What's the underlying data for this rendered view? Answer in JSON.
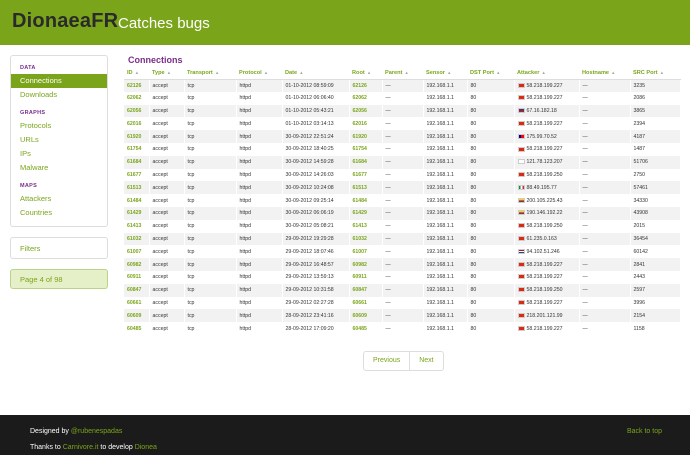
{
  "header": {
    "brand": "DionaeaFR",
    "tagline": "Catches bugs"
  },
  "sidebar": {
    "data_header": "DATA",
    "data_items": [
      "Connections",
      "Downloads"
    ],
    "graphs_header": "GRAPHS",
    "graphs_items": [
      "Protocols",
      "URLs",
      "IPs",
      "Malware"
    ],
    "maps_header": "MAPS",
    "maps_items": [
      "Attackers",
      "Countries"
    ],
    "filters": "Filters",
    "page_info": "Page 4 of 98"
  },
  "main": {
    "title": "Connections",
    "columns": [
      "ID",
      "Type",
      "Transport",
      "Protocol",
      "Date",
      "Root",
      "Parent",
      "Sensor",
      "DST Port",
      "Attacker",
      "Hostname",
      "SRC Port"
    ],
    "rows": [
      [
        "62126",
        "accept",
        "tcp",
        "httpd",
        "01-10-2012 08:59:09",
        "62126",
        "—",
        "192.168.1.1",
        "80",
        "58.218.199.227",
        "—",
        "3235"
      ],
      [
        "62062",
        "accept",
        "tcp",
        "httpd",
        "01-10-2012 06:06:40",
        "62062",
        "—",
        "192.168.1.1",
        "80",
        "58.218.199.227",
        "—",
        "2086"
      ],
      [
        "62056",
        "accept",
        "tcp",
        "httpd",
        "01-10-2012 05:43:21",
        "62056",
        "—",
        "192.168.1.1",
        "80",
        "67.16.182.18",
        "—",
        "3865"
      ],
      [
        "62016",
        "accept",
        "tcp",
        "httpd",
        "01-10-2012 03:14:13",
        "62016",
        "—",
        "192.168.1.1",
        "80",
        "58.218.199.227",
        "—",
        "2394"
      ],
      [
        "61920",
        "accept",
        "tcp",
        "httpd",
        "30-09-2012 22:51:24",
        "61920",
        "—",
        "192.168.1.1",
        "80",
        "175.99.70.52",
        "—",
        "4187"
      ],
      [
        "61754",
        "accept",
        "tcp",
        "httpd",
        "30-09-2012 18:40:25",
        "61754",
        "—",
        "192.168.1.1",
        "80",
        "58.218.199.227",
        "—",
        "1487"
      ],
      [
        "61684",
        "accept",
        "tcp",
        "httpd",
        "30-09-2012 14:59:28",
        "61684",
        "—",
        "192.168.1.1",
        "80",
        "121.78.123.207",
        "—",
        "51706"
      ],
      [
        "61677",
        "accept",
        "tcp",
        "httpd",
        "30-09-2012 14:26:03",
        "61677",
        "—",
        "192.168.1.1",
        "80",
        "58.218.199.250",
        "—",
        "2750"
      ],
      [
        "61513",
        "accept",
        "tcp",
        "httpd",
        "30-09-2012 10:24:08",
        "61513",
        "—",
        "192.168.1.1",
        "80",
        "88.49.195.77",
        "—",
        "57461"
      ],
      [
        "61484",
        "accept",
        "tcp",
        "httpd",
        "30-09-2012 09:25:14",
        "61484",
        "—",
        "192.168.1.1",
        "80",
        "200.105.225.43",
        "—",
        "34330"
      ],
      [
        "61429",
        "accept",
        "tcp",
        "httpd",
        "30-09-2012 06:06:19",
        "61429",
        "—",
        "192.168.1.1",
        "80",
        "190.146.192.22",
        "—",
        "43908"
      ],
      [
        "61413",
        "accept",
        "tcp",
        "httpd",
        "30-09-2012 05:08:21",
        "61413",
        "—",
        "192.168.1.1",
        "80",
        "58.218.199.250",
        "—",
        "2015"
      ],
      [
        "61032",
        "accept",
        "tcp",
        "httpd",
        "29-09-2012 19:29:28",
        "61032",
        "—",
        "192.168.1.1",
        "80",
        "61.235.0.163",
        "—",
        "36454"
      ],
      [
        "61007",
        "accept",
        "tcp",
        "httpd",
        "29-09-2012 18:07:46",
        "61007",
        "—",
        "192.168.1.1",
        "80",
        "94.102.51.246",
        "—",
        "60142"
      ],
      [
        "60982",
        "accept",
        "tcp",
        "httpd",
        "29-09-2012 16:48:57",
        "60982",
        "—",
        "192.168.1.1",
        "80",
        "58.218.199.227",
        "—",
        "2841"
      ],
      [
        "60911",
        "accept",
        "tcp",
        "httpd",
        "29-09-2012 13:59:13",
        "60911",
        "—",
        "192.168.1.1",
        "80",
        "58.218.199.227",
        "—",
        "2443"
      ],
      [
        "60847",
        "accept",
        "tcp",
        "httpd",
        "29-09-2012 10:31:58",
        "60847",
        "—",
        "192.168.1.1",
        "80",
        "58.218.199.250",
        "—",
        "2597"
      ],
      [
        "60661",
        "accept",
        "tcp",
        "httpd",
        "29-09-2012 02:27:28",
        "60661",
        "—",
        "192.168.1.1",
        "80",
        "58.218.199.227",
        "—",
        "3996"
      ],
      [
        "60609",
        "accept",
        "tcp",
        "httpd",
        "28-09-2012 23:41:16",
        "60609",
        "—",
        "192.168.1.1",
        "80",
        "218.201.121.99",
        "—",
        "2154"
      ],
      [
        "60485",
        "accept",
        "tcp",
        "httpd",
        "28-09-2012 17:09:20",
        "60485",
        "—",
        "192.168.1.1",
        "80",
        "58.218.199.227",
        "—",
        "1158"
      ]
    ],
    "flags": [
      "cn",
      "cn",
      "us",
      "cn",
      "tw",
      "cn",
      "kr",
      "cn",
      "it",
      "co",
      "co",
      "cn",
      "cn",
      "nl",
      "cn",
      "cn",
      "cn",
      "cn",
      "cn",
      "cn"
    ]
  },
  "pager": {
    "previous": "Previous",
    "next": "Next"
  },
  "footer": {
    "designed_prefix": "Designed by ",
    "designed_by": "@rubenespadas",
    "thanks_prefix": "Thanks to ",
    "carnivore": "Carnivore.it",
    "thanks_middle": " to develop ",
    "dionaea": "Dionea",
    "back_to_top": "Back to top"
  },
  "colors": {
    "accent": "#7aa51b",
    "heading": "#7b2d8b",
    "footer_bg": "#1b1b1b"
  }
}
